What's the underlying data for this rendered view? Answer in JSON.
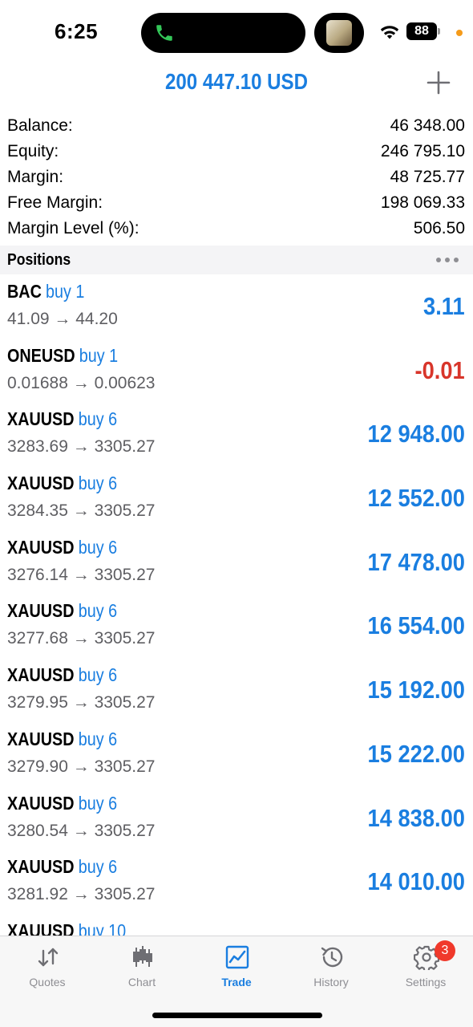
{
  "status": {
    "time": "6:25",
    "battery": "88"
  },
  "header": {
    "title": "200 447.10 USD"
  },
  "summary": [
    {
      "label": "Balance:",
      "value": "46 348.00"
    },
    {
      "label": "Equity:",
      "value": "246 795.10"
    },
    {
      "label": "Margin:",
      "value": "48 725.77"
    },
    {
      "label": "Free Margin:",
      "value": "198 069.33"
    },
    {
      "label": "Margin Level (%):",
      "value": "506.50"
    }
  ],
  "positions_section": {
    "title": "Positions"
  },
  "positions": [
    {
      "symbol": "BAC",
      "side": "buy 1",
      "prices": "41.09 → 44.20",
      "profit": "3.11",
      "negative": false
    },
    {
      "symbol": "ONEUSD",
      "side": "buy 1",
      "prices": "0.01688 → 0.00623",
      "profit": "-0.01",
      "negative": true
    },
    {
      "symbol": "XAUUSD",
      "side": "buy 6",
      "prices": "3283.69 → 3305.27",
      "profit": "12 948.00",
      "negative": false
    },
    {
      "symbol": "XAUUSD",
      "side": "buy 6",
      "prices": "3284.35 → 3305.27",
      "profit": "12 552.00",
      "negative": false
    },
    {
      "symbol": "XAUUSD",
      "side": "buy 6",
      "prices": "3276.14 → 3305.27",
      "profit": "17 478.00",
      "negative": false
    },
    {
      "symbol": "XAUUSD",
      "side": "buy 6",
      "prices": "3277.68 → 3305.27",
      "profit": "16 554.00",
      "negative": false
    },
    {
      "symbol": "XAUUSD",
      "side": "buy 6",
      "prices": "3279.95 → 3305.27",
      "profit": "15 192.00",
      "negative": false
    },
    {
      "symbol": "XAUUSD",
      "side": "buy 6",
      "prices": "3279.90 → 3305.27",
      "profit": "15 222.00",
      "negative": false
    },
    {
      "symbol": "XAUUSD",
      "side": "buy 6",
      "prices": "3280.54 → 3305.27",
      "profit": "14 838.00",
      "negative": false
    },
    {
      "symbol": "XAUUSD",
      "side": "buy 6",
      "prices": "3281.92 → 3305.27",
      "profit": "14 010.00",
      "negative": false
    },
    {
      "symbol": "XAUUSD",
      "side": "buy 10",
      "prices": "",
      "profit": "",
      "negative": false
    }
  ],
  "tabs": [
    {
      "label": "Quotes",
      "icon": "arrows-up-down-icon",
      "active": false
    },
    {
      "label": "Chart",
      "icon": "candlestick-icon",
      "active": false
    },
    {
      "label": "Trade",
      "icon": "trade-chart-icon",
      "active": true
    },
    {
      "label": "History",
      "icon": "history-icon",
      "active": false
    },
    {
      "label": "Settings",
      "icon": "gear-icon",
      "active": false,
      "badge": "3"
    }
  ],
  "colors": {
    "accent": "#1a7ee0",
    "negative": "#d8352a",
    "badge": "#f0392b"
  }
}
